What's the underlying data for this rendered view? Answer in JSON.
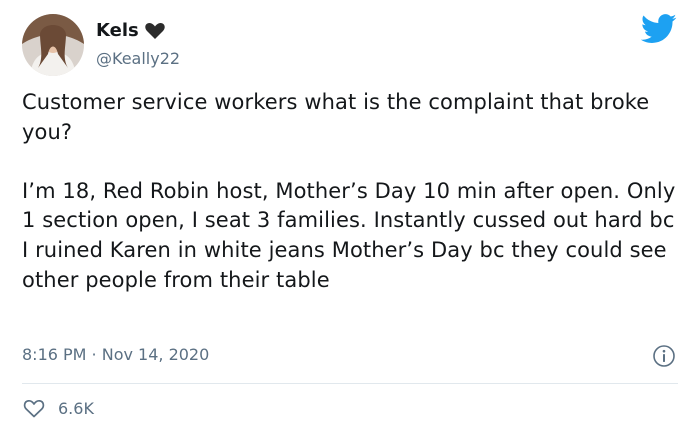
{
  "user": {
    "display_name": "Kels",
    "handle": "@Keally22"
  },
  "tweet": {
    "question": "Customer service workers what is the complaint that broke you?",
    "story": "I’m 18, Red Robin host, Mother’s Day 10 min after open. Only 1 section open, I seat 3 families. Instantly cussed out hard bc I ruined Karen in white jeans Mother’s Day bc they could see other people from their table"
  },
  "meta": {
    "timestamp": "8:16 PM · Nov 14, 2020"
  },
  "actions": {
    "like_count": "6.6K"
  },
  "icons": {
    "name_suffix": "black-heart-icon",
    "brand": "twitter-bird-icon",
    "info": "info-icon",
    "like": "heart-outline-icon"
  },
  "colors": {
    "twitter_blue": "#1da1f2",
    "secondary_text": "#5b7083",
    "divider": "#e1e8ed"
  }
}
